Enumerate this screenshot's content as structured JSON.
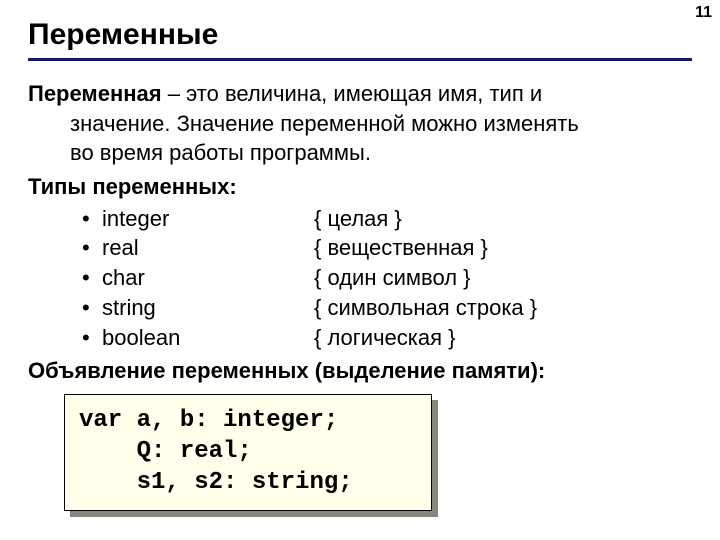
{
  "page_number": "11",
  "title": "Переменные",
  "definition": {
    "term": "Переменная",
    "rest_line1": " – это величина, имеющая имя, тип и",
    "line2": "значение. Значение переменной можно изменять",
    "line3": "во время работы программы."
  },
  "types_heading": "Типы переменных:",
  "types": [
    {
      "name": "integer",
      "desc": "{ целая }"
    },
    {
      "name": "real",
      "desc": "{ вещественная }"
    },
    {
      "name": "char",
      "desc": "{ один символ }"
    },
    {
      "name": "string",
      "desc": "{ символьная строка }"
    },
    {
      "name": "boolean",
      "desc": "{ логическая }"
    }
  ],
  "decl_heading": "Объявление переменных (выделение памяти):",
  "code": {
    "l1": "var a, b: integer;",
    "l2": "    Q: real;",
    "l3": "    s1, s2: string;"
  }
}
